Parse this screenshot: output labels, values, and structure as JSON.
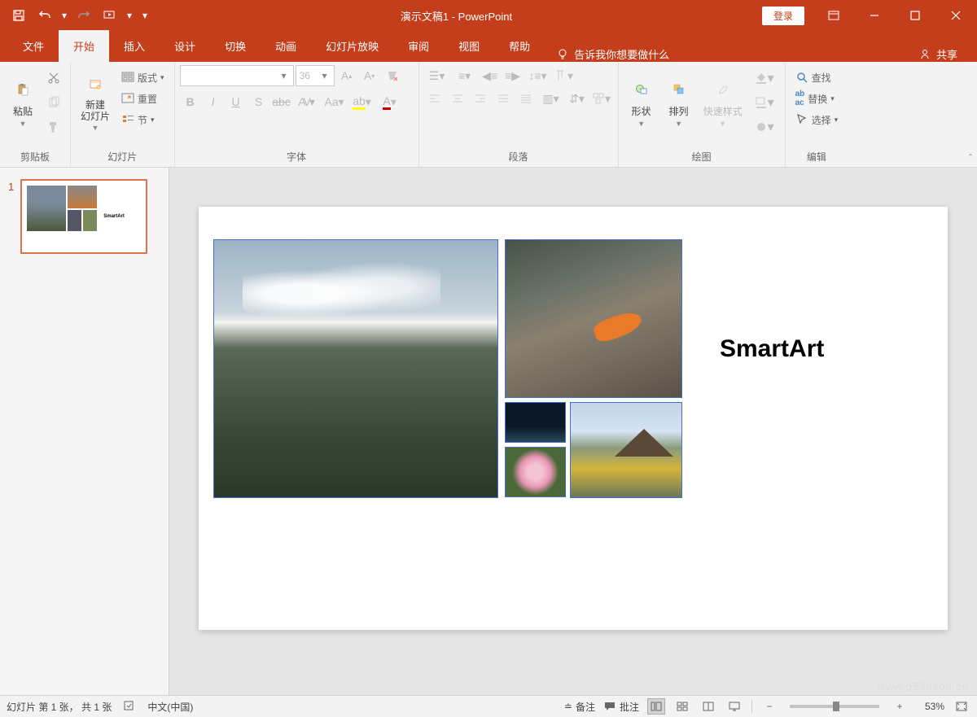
{
  "titlebar": {
    "title": "演示文稿1 - PowerPoint",
    "login": "登录"
  },
  "tabs": {
    "file": "文件",
    "home": "开始",
    "insert": "插入",
    "design": "设计",
    "transitions": "切换",
    "animations": "动画",
    "slideshow": "幻灯片放映",
    "review": "审阅",
    "view": "视图",
    "help": "帮助",
    "tellme": "告诉我你想要做什么",
    "share": "共享"
  },
  "ribbon": {
    "clipboard": {
      "label": "剪贴板",
      "paste": "粘贴"
    },
    "slides": {
      "label": "幻灯片",
      "new_slide": "新建\n幻灯片",
      "layout": "版式",
      "reset": "重置",
      "section": "节"
    },
    "font": {
      "label": "字体",
      "size": "36"
    },
    "paragraph": {
      "label": "段落"
    },
    "drawing": {
      "label": "绘图",
      "shapes": "形状",
      "arrange": "排列",
      "quickstyles": "快速样式"
    },
    "editing": {
      "label": "编辑",
      "find": "查找",
      "replace": "替换",
      "select": "选择"
    }
  },
  "thumbnails": {
    "n1": "1"
  },
  "slide": {
    "smartart": "SmartArt"
  },
  "statusbar": {
    "slide_info": "幻灯片 第 1 张， 共 1 张",
    "language": "中文(中国)",
    "notes": "备注",
    "comments": "批注",
    "zoom": "53%"
  },
  "watermark": "www.q538son.cn"
}
